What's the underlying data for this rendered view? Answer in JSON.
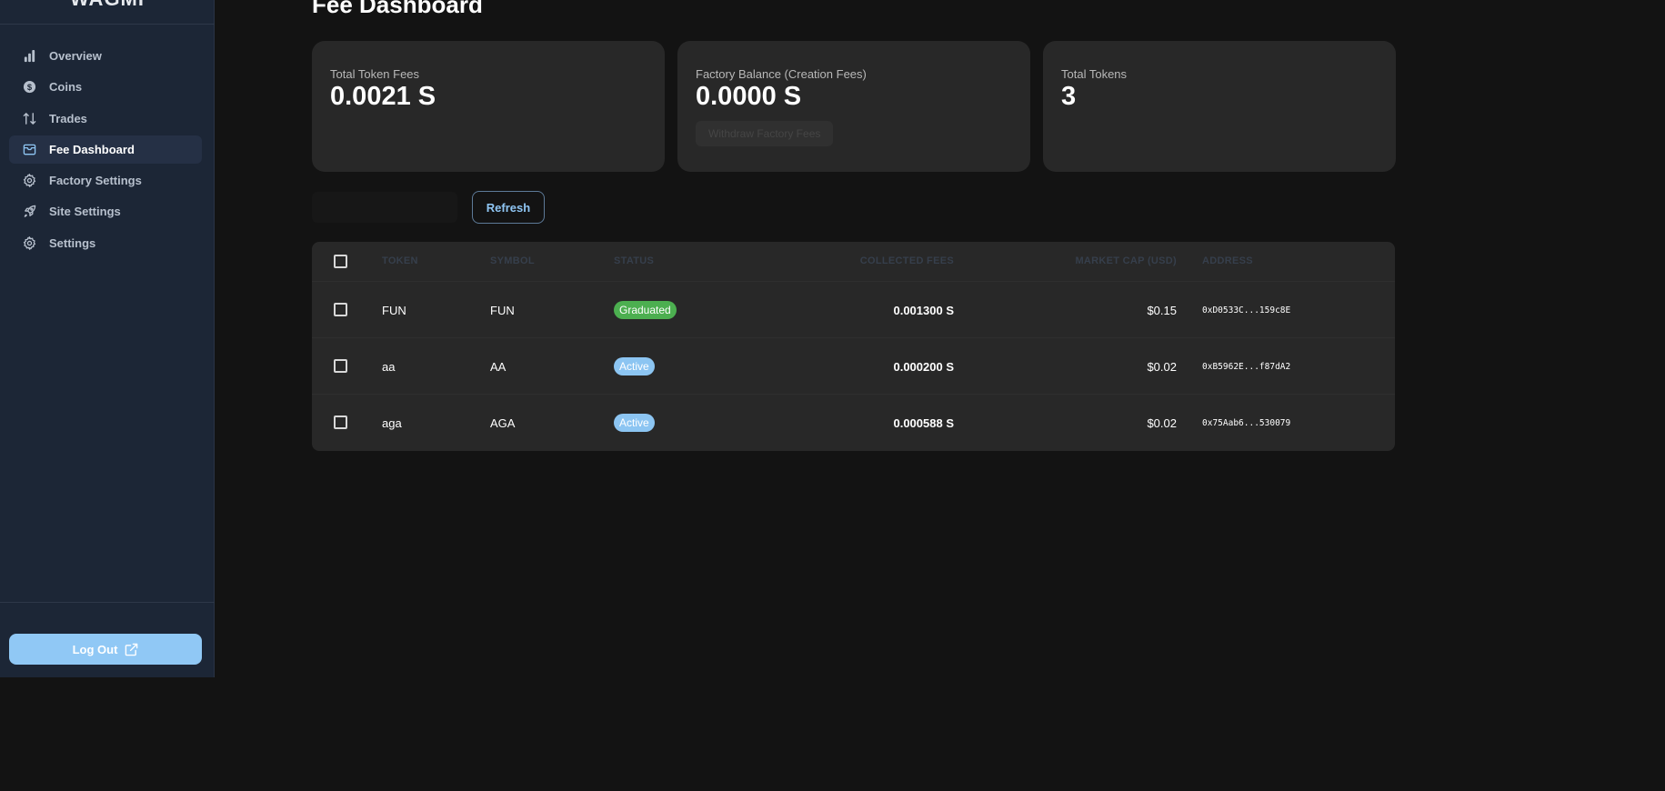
{
  "sidebar": {
    "brand": "WAGMI",
    "items": [
      {
        "label": "Overview",
        "icon": "bar-chart-icon",
        "active": false
      },
      {
        "label": "Coins",
        "icon": "dollar-coin-icon",
        "active": false
      },
      {
        "label": "Trades",
        "icon": "arrows-up-down-icon",
        "active": false
      },
      {
        "label": "Fee Dashboard",
        "icon": "wallet-icon",
        "active": true
      },
      {
        "label": "Factory Settings",
        "icon": "gear-icon",
        "active": false
      },
      {
        "label": "Site Settings",
        "icon": "rocket-icon",
        "active": false
      },
      {
        "label": "Settings",
        "icon": "gear-icon",
        "active": false
      }
    ],
    "logout_label": "Log Out",
    "logout_icon": "external-link-icon"
  },
  "main": {
    "title": "Fee Dashboard",
    "cards": [
      {
        "label": "Total Token Fees",
        "value": "0.0021 S"
      },
      {
        "label": "Factory Balance (Creation Fees)",
        "value": "0.0000 S",
        "button": "Withdraw Factory Fees"
      },
      {
        "label": "Total Tokens",
        "value": "3"
      }
    ],
    "refresh_label": "Refresh"
  },
  "table": {
    "headers": [
      "TOKEN",
      "SYMBOL",
      "STATUS",
      "COLLECTED FEES",
      "MARKET CAP (USD)",
      "ADDRESS"
    ],
    "rows": [
      {
        "token": "FUN",
        "symbol": "FUN",
        "status": "Graduated",
        "fees": "0.001300 S",
        "mcap": "$0.15",
        "address": "0xD0533C...159c8E"
      },
      {
        "token": "aa",
        "symbol": "AA",
        "status": "Active",
        "fees": "0.000200 S",
        "mcap": "$0.02",
        "address": "0xB5962E...f87dA2"
      },
      {
        "token": "aga",
        "symbol": "AGA",
        "status": "Active",
        "fees": "0.000588 S",
        "mcap": "$0.02",
        "address": "0x75Aab6...530079"
      }
    ]
  },
  "colors": {
    "accent": "#90c8f5",
    "graduated": "#4caf50",
    "active": "#8cc5f2",
    "sidebar_bg": "#1c2636",
    "card_bg": "#282828"
  }
}
